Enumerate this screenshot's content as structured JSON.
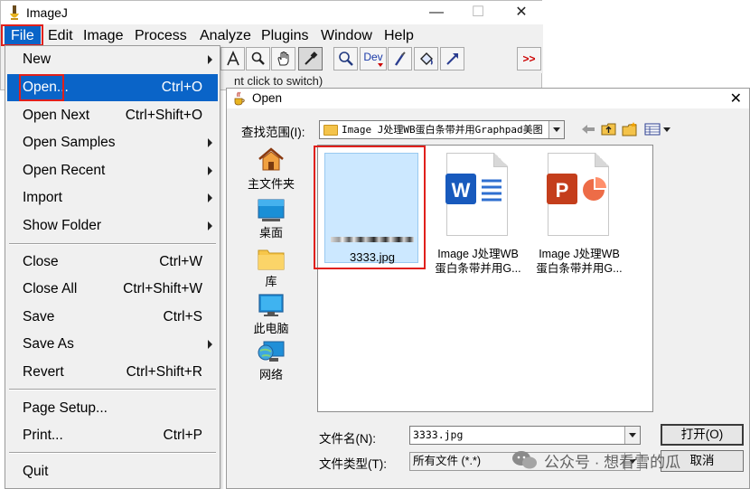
{
  "window": {
    "title": "ImageJ",
    "controls": {
      "minimize": "—",
      "maximize": "☐",
      "close": "✕"
    },
    "status_text": "nt click to switch)"
  },
  "menubar": {
    "items": [
      "File",
      "Edit",
      "Image",
      "Process",
      "Analyze",
      "Plugins",
      "Window",
      "Help"
    ]
  },
  "toolbar": {
    "tools": [
      "text-tool",
      "magnifier-tool",
      "scroll-tool",
      "color-picker-tool",
      "zoom-tool",
      "developer-menu",
      "paintbrush-tool",
      "flood-fill-tool",
      "arrow-tool",
      "more-tools"
    ],
    "dev_label": "Dev",
    "more_label": ">>"
  },
  "file_menu": {
    "items": [
      {
        "label": "New",
        "shortcut": "",
        "submenu": true
      },
      {
        "label": "Open...",
        "shortcut": "Ctrl+O",
        "submenu": false,
        "highlighted": true
      },
      {
        "label": "Open Next",
        "shortcut": "Ctrl+Shift+O",
        "submenu": false
      },
      {
        "label": "Open Samples",
        "shortcut": "",
        "submenu": true
      },
      {
        "label": "Open Recent",
        "shortcut": "",
        "submenu": true
      },
      {
        "label": "Import",
        "shortcut": "",
        "submenu": true
      },
      {
        "label": "Show Folder",
        "shortcut": "",
        "submenu": true
      },
      {
        "label": "Close",
        "shortcut": "Ctrl+W",
        "submenu": false
      },
      {
        "label": "Close All",
        "shortcut": "Ctrl+Shift+W",
        "submenu": false
      },
      {
        "label": "Save",
        "shortcut": "Ctrl+S",
        "submenu": false
      },
      {
        "label": "Save As",
        "shortcut": "",
        "submenu": true
      },
      {
        "label": "Revert",
        "shortcut": "Ctrl+Shift+R",
        "submenu": false
      },
      {
        "label": "Page Setup...",
        "shortcut": "",
        "submenu": false
      },
      {
        "label": "Print...",
        "shortcut": "Ctrl+P",
        "submenu": false
      },
      {
        "label": "Quit",
        "shortcut": "",
        "submenu": false
      }
    ]
  },
  "dialog": {
    "title": "Open",
    "close": "✕",
    "look_in_label": "查找范围(I):",
    "look_in_value": "Image J处理WB蛋白条带并用Graphpad美图",
    "places": [
      {
        "label": "主文件夹",
        "icon": "home-icon"
      },
      {
        "label": "桌面",
        "icon": "desktop-icon"
      },
      {
        "label": "库",
        "icon": "library-folder-icon"
      },
      {
        "label": "此电脑",
        "icon": "computer-icon"
      },
      {
        "label": "网络",
        "icon": "network-icon"
      }
    ],
    "files": [
      {
        "name": "3333.jpg",
        "selected": true
      },
      {
        "name_line1": "Image J处理WB",
        "name_line2": "蛋白条带并用G...",
        "type": "word"
      },
      {
        "name_line1": "Image J处理WB",
        "name_line2": "蛋白条带并用G...",
        "type": "powerpoint"
      }
    ],
    "file_name_label": "文件名(N):",
    "file_name_value": "3333.jpg",
    "file_type_label": "文件类型(T):",
    "file_type_value": "所有文件 (*.*)",
    "open_button": "打开(O)",
    "cancel_button": "取消"
  },
  "watermark": {
    "text": "公众号 · 想看雪的瓜"
  },
  "colors": {
    "highlight": "#0a64c8",
    "annotation_red": "#e0201c",
    "selection_bg": "#cce8ff"
  }
}
